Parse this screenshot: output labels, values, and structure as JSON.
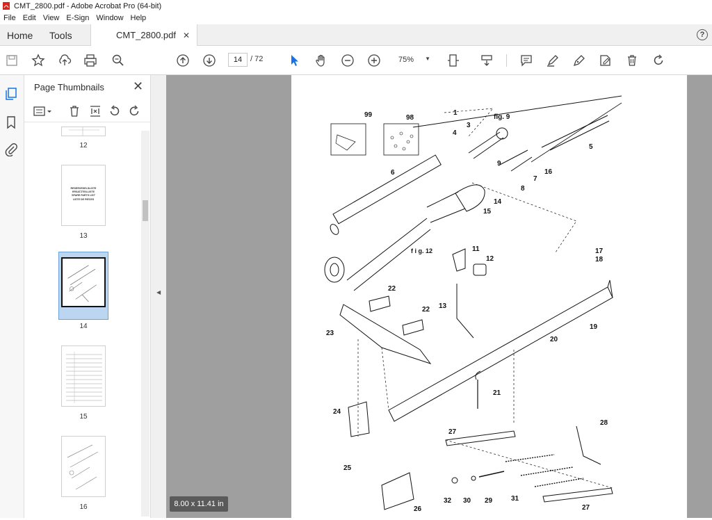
{
  "window": {
    "title": "CMT_2800.pdf - Adobe Acrobat Pro (64-bit)"
  },
  "menu": [
    "File",
    "Edit",
    "View",
    "E-Sign",
    "Window",
    "Help"
  ],
  "tabs": {
    "home": "Home",
    "tools": "Tools",
    "document": "CMT_2800.pdf",
    "close": "✕",
    "help": "?"
  },
  "toolbar": {
    "current_page": "14",
    "total_pages": "/ 72",
    "zoom": "75%"
  },
  "panel": {
    "title": "Page Thumbnails",
    "thumbnails": [
      {
        "label": "12"
      },
      {
        "label": "13",
        "text": [
          "RESERVEDELSLISTE",
          "ERSATZTEILLISTE",
          "SPARE PARTS LIST",
          "LISTE DE PIÈCES"
        ]
      },
      {
        "label": "14",
        "selected": true
      },
      {
        "label": "15"
      },
      {
        "label": "16"
      }
    ]
  },
  "page_size": "8.00 x 11.41 in",
  "drawing": {
    "callouts": [
      "99",
      "98",
      "1",
      "fig. 9",
      "4",
      "3",
      "5",
      "6",
      "9",
      "16",
      "7",
      "8",
      "14",
      "15",
      "f i g. 12",
      "11",
      "12",
      "17",
      "18",
      "22",
      "22",
      "13",
      "23",
      "20",
      "19",
      "21",
      "24",
      "27",
      "28",
      "25",
      "26",
      "32",
      "30",
      "29",
      "31",
      "27"
    ]
  },
  "colors": {
    "accent": "#1473e6",
    "viewer_bg": "#9f9f9f",
    "selection": "#bcd6f1"
  }
}
